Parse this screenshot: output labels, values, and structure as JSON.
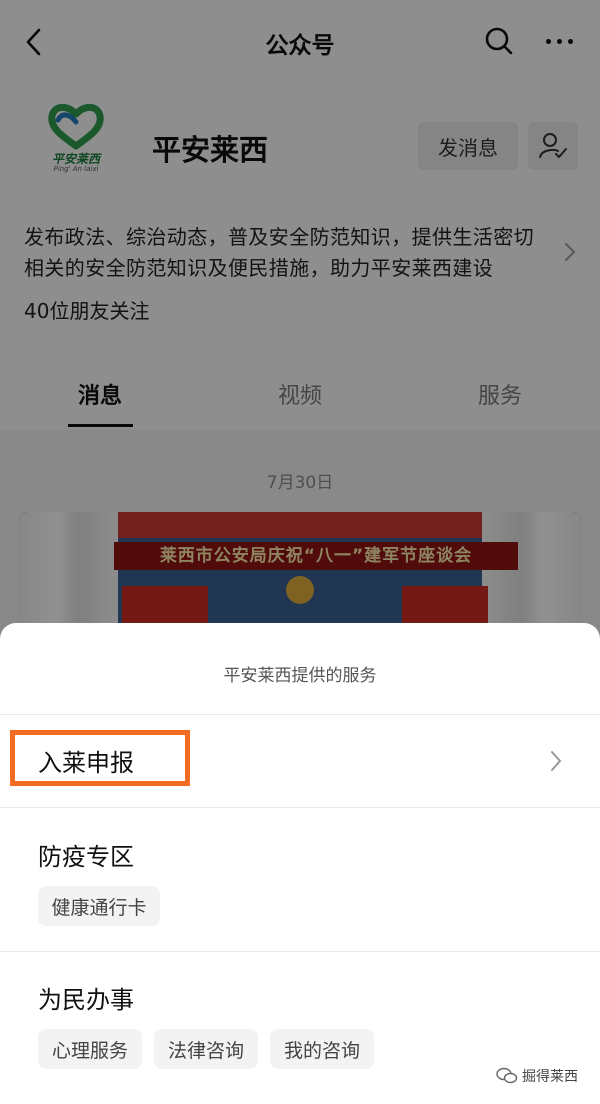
{
  "topbar": {
    "title": "公众号",
    "back_icon": "chevron-left-icon",
    "search_icon": "search-icon",
    "more_icon": "more-icon"
  },
  "account": {
    "logo_text": "平安莱西",
    "logo_subtext": "Ping' An laixi",
    "name": "平安莱西",
    "message_button": "发消息",
    "follow_icon": "user-check-icon",
    "description_line1": "发布政法、综治动态，普及安全防范知识，提供生活密切",
    "description_line2": "相关的安全防范知识及便民措施，助力平安莱西建设",
    "followers": "40位朋友关注"
  },
  "tabs": [
    {
      "label": "消息",
      "active": true
    },
    {
      "label": "视频",
      "active": false
    },
    {
      "label": "服务",
      "active": false
    }
  ],
  "feed": {
    "date": "7月30日",
    "article_banner": "莱西市公安局庆祝“八一”建军节座谈会"
  },
  "sheet": {
    "title": "平安莱西提供的服务",
    "highlight_color": "#f26d21",
    "items": [
      {
        "label": "入莱申报"
      },
      {
        "label": "防疫专区",
        "chips": [
          "健康通行卡"
        ]
      },
      {
        "label": "为民办事",
        "chips": [
          "心理服务",
          "法律咨询",
          "我的咨询"
        ]
      }
    ]
  },
  "watermark": {
    "text": "掘得莱西",
    "icon": "wechat-icon"
  }
}
